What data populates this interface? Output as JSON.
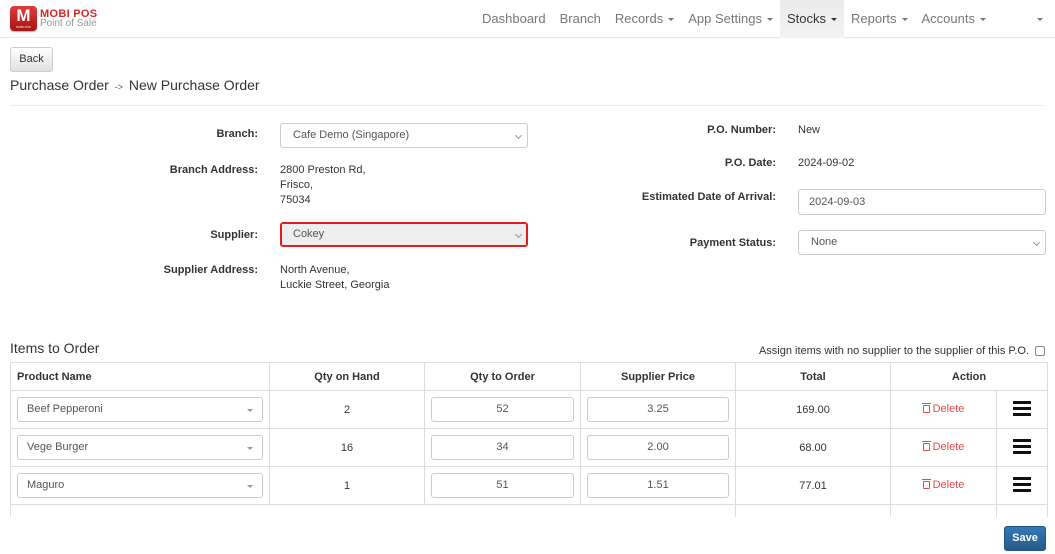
{
  "brand": {
    "logo_letter": "M",
    "logo_sub": "MOBI POS",
    "title": "MOBI POS",
    "subtitle": "Point of Sale"
  },
  "nav": {
    "items": [
      {
        "label": "Dashboard",
        "dropdown": false,
        "active": false
      },
      {
        "label": "Branch",
        "dropdown": false,
        "active": false
      },
      {
        "label": "Records",
        "dropdown": true,
        "active": false
      },
      {
        "label": "App Settings",
        "dropdown": true,
        "active": false
      },
      {
        "label": "Stocks",
        "dropdown": true,
        "active": true
      },
      {
        "label": "Reports",
        "dropdown": true,
        "active": false
      },
      {
        "label": "Accounts",
        "dropdown": true,
        "active": false
      }
    ]
  },
  "page": {
    "back_label": "Back",
    "breadcrumb_parent": "Purchase Order",
    "breadcrumb_sep": "->",
    "breadcrumb_current": "New Purchase Order"
  },
  "form": {
    "branch_label": "Branch:",
    "branch_value": "Cafe Demo (Singapore)",
    "branch_address_label": "Branch Address:",
    "branch_address_lines": [
      "2800 Preston Rd,",
      "Frisco,",
      "75034"
    ],
    "supplier_label": "Supplier:",
    "supplier_value": "Cokey",
    "supplier_address_label": "Supplier Address:",
    "supplier_address_lines": [
      "North Avenue,",
      "Luckie Street, Georgia"
    ],
    "po_number_label": "P.O. Number:",
    "po_number_value": "New",
    "po_date_label": "P.O. Date:",
    "po_date_value": "2024-09-02",
    "eta_label": "Estimated Date of Arrival:",
    "eta_value": "2024-09-03",
    "payment_status_label": "Payment Status:",
    "payment_status_value": "None"
  },
  "items": {
    "title": "Items to Order",
    "assign_label": "Assign items with no supplier to the supplier of this P.O.",
    "assign_checked": false,
    "columns": [
      "Product Name",
      "Qty on Hand",
      "Qty to Order",
      "Supplier Price",
      "Total",
      "Action"
    ],
    "delete_label": "Delete",
    "rows": [
      {
        "product": "Beef Pepperoni",
        "qty_on_hand": "2",
        "qty_to_order": "52",
        "supplier_price": "3.25",
        "total": "169.00"
      },
      {
        "product": "Vege Burger",
        "qty_on_hand": "16",
        "qty_to_order": "34",
        "supplier_price": "2.00",
        "total": "68.00"
      },
      {
        "product": "Maguro",
        "qty_on_hand": "1",
        "qty_to_order": "51",
        "supplier_price": "1.51",
        "total": "77.01"
      }
    ]
  },
  "footer": {
    "save_label": "Save"
  },
  "colors": {
    "brand_red": "#d42727",
    "delete_red": "#e64a4a",
    "error_border": "#e31b1b",
    "primary_blue": "#2e6da4"
  }
}
